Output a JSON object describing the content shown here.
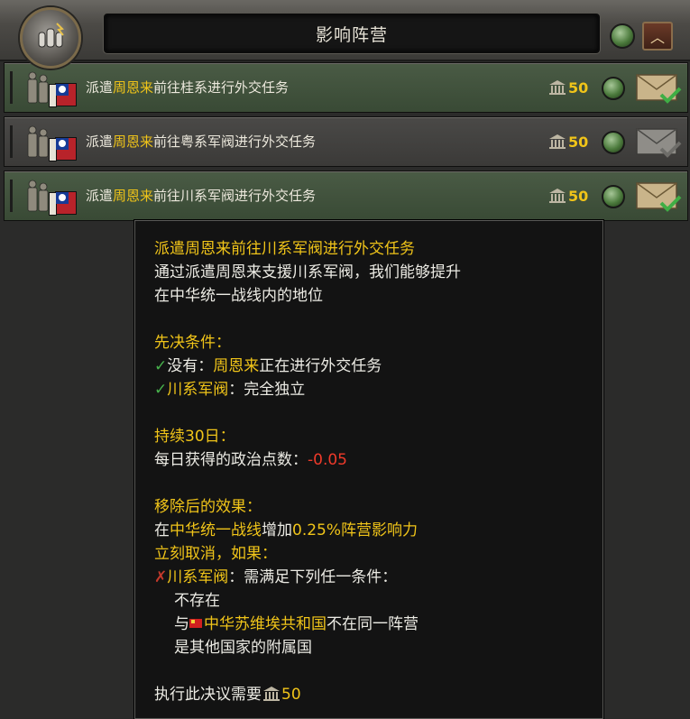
{
  "header": {
    "title": "影响阵营",
    "emblem_icon": "faction-fists-icon",
    "status_icon": "green-light-icon",
    "collapse_icon": "chevron-up-icon"
  },
  "decisions": [
    {
      "prefix": "派遣",
      "highlight": "周恩来",
      "suffix": "前往桂系进行外交任务",
      "cost": "50",
      "mail_state": "available"
    },
    {
      "prefix": "派遣",
      "highlight": "周恩来",
      "suffix": "前往粤系军阀进行外交任务",
      "cost": "50",
      "mail_state": "unavailable"
    },
    {
      "prefix": "派遣",
      "highlight": "周恩来",
      "suffix": "前往川系军阀进行外交任务",
      "cost": "50",
      "mail_state": "available"
    }
  ],
  "tooltip": {
    "title": "派遣周恩来前往川系军阀进行外交任务",
    "desc1": "通过派遣周恩来支援川系军阀，我们能够提升",
    "desc2": "在中华统一战线内的地位",
    "prereq_header": "先决条件：",
    "prereq1_a": "没有：",
    "prereq1_b": "周恩来",
    "prereq1_c": "正在进行外交任务",
    "prereq2_a": "川系军阀",
    "prereq2_b": "：完全独立",
    "duration_header": "持续30日：",
    "daily_label": "每日获得的政治点数：",
    "daily_value": "-0.05",
    "effects_header": "移除后的效果：",
    "effect_a": "在",
    "effect_b": "中华统一战线",
    "effect_c": "增加",
    "effect_d": "0.25%阵营影响力",
    "cancel_header": "立刻取消，如果：",
    "cancel_a": "川系军阀",
    "cancel_b": "：需满足下列任一条件：",
    "cond1": "不存在",
    "cond2_a": "与",
    "cond2_b": "中华苏维埃共和国",
    "cond2_c": "不在同一阵营",
    "cond3": "是其他国家的附属国",
    "cost_label": "执行此决议需要",
    "cost_value": "50",
    "colors": {
      "highlight": "#f0c419",
      "negative": "#ef3a2a",
      "check": "#47b24c",
      "cross": "#c5392b"
    }
  }
}
